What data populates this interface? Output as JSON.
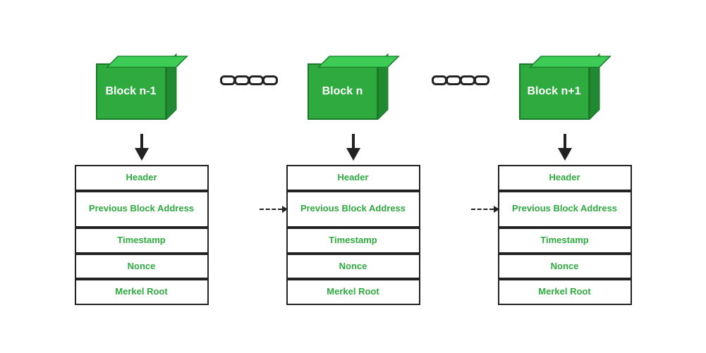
{
  "blocks": [
    {
      "id": "block-n-minus-1",
      "label": "Block n-1",
      "fields": {
        "header": "Header",
        "prev_block": "Previous Block Address",
        "timestamp": "Timestamp",
        "nonce": "Nonce",
        "merkel": "Merkel Root"
      }
    },
    {
      "id": "block-n",
      "label": "Block n",
      "fields": {
        "header": "Header",
        "prev_block": "Previous Block Address",
        "timestamp": "Timestamp",
        "nonce": "Nonce",
        "merkel": "Merkel Root"
      }
    },
    {
      "id": "block-n-plus-1",
      "label": "Block n+1",
      "fields": {
        "header": "Header",
        "prev_block": "Previous Block Address",
        "timestamp": "Timestamp",
        "nonce": "Nonce",
        "merkel": "Merkel Root"
      }
    }
  ],
  "chain": {
    "link_count": 4
  }
}
